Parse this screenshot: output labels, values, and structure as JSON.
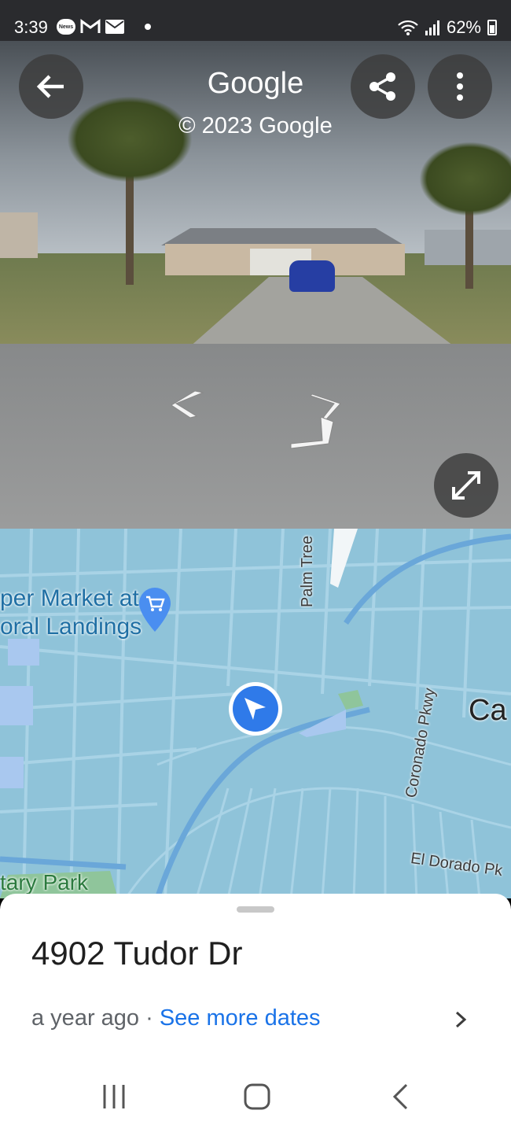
{
  "status_bar": {
    "time": "3:39",
    "news_badge": "News",
    "battery": "62%",
    "icons": [
      "news-icon",
      "gmail-icon",
      "mail-icon",
      "notification-dot",
      "wifi-icon",
      "signal-icon",
      "battery-icon"
    ]
  },
  "street_view": {
    "title": "Google",
    "copyright": "© 2023 Google",
    "buttons": [
      "back-arrow-icon",
      "share-icon",
      "more-vert-icon",
      "expand-icon"
    ]
  },
  "map": {
    "labels": {
      "market": [
        "per Market at",
        "oral Landings"
      ],
      "palm_tree": "Palm Tree",
      "coronado": "Coronado Pkwy",
      "ca": "Ca",
      "el_dorado": "El Dorado Pk",
      "park": "tary Park"
    },
    "colors": {
      "water": "#8fc3d9",
      "road": "#a9d3e6",
      "accent": "#1a73e8"
    }
  },
  "sheet": {
    "address": "4902 Tudor Dr",
    "age": "a year ago",
    "separator": " · ",
    "see_more": "See more dates"
  },
  "nav_bar": {
    "items": [
      "recent-apps-icon",
      "home-icon",
      "back-icon"
    ]
  }
}
